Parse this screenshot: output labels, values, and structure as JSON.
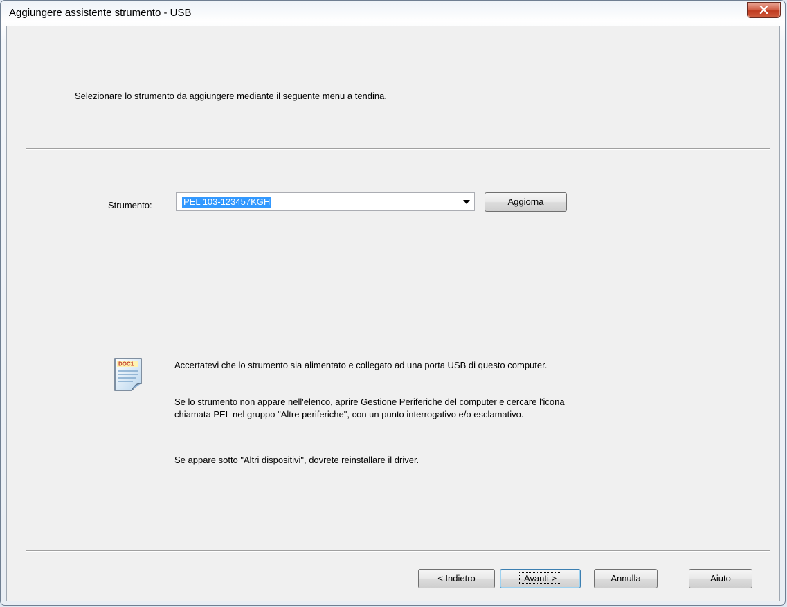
{
  "window": {
    "title": "Aggiungere assistente strumento - USB"
  },
  "header": {
    "instruction": "Selezionare lo strumento da aggiungere mediante il seguente menu a tendina."
  },
  "instrument": {
    "label": "Strumento:",
    "selected_value": "PEL 103-123457KGH",
    "refresh_label": "Aggiorna"
  },
  "info": {
    "icon": "document-icon",
    "icon_text": "DOC1",
    "p1": "Accertatevi che lo strumento sia alimentato e  collegato ad una porta USB di questo computer.",
    "p2_line1": "Se lo strumento non appare nell'elenco, aprire Gestione Periferiche del computer e cercare l'icona",
    "p2_line2": "chiamata PEL nel gruppo \"Altre periferiche\", con un punto interrogativo e/o esclamativo.",
    "p3": "Se appare sotto \"Altri dispositivi\", dovrete reinstallare il driver."
  },
  "footer": {
    "back_label": "< Indietro",
    "next_label": "Avanti >",
    "cancel_label": "Annulla",
    "help_label": "Aiuto"
  },
  "colors": {
    "selection": "#3399ff",
    "close_button": "#c7432a",
    "dialog_bg": "#f0f0f0"
  }
}
